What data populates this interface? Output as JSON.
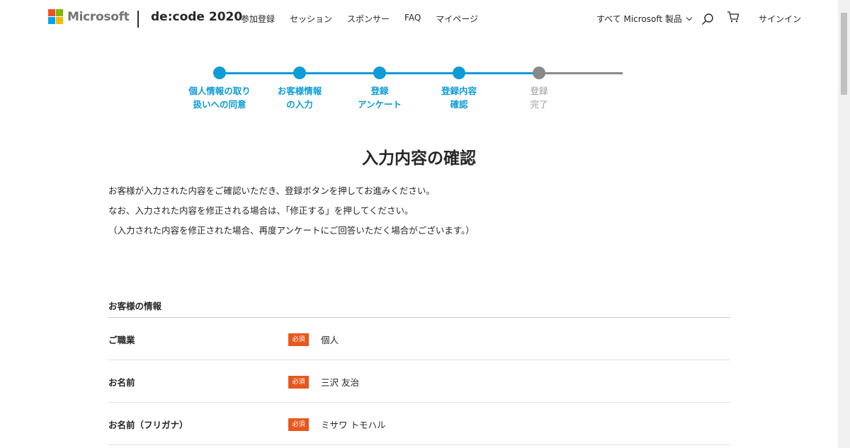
{
  "header": {
    "brand_text": "Microsoft",
    "logo_colors": [
      "#f25022",
      "#7fba00",
      "#00a4ef",
      "#ffb900"
    ],
    "site_title": "de:code 2020",
    "nav": [
      "参加登録",
      "セッション",
      "スポンサー",
      "FAQ",
      "マイページ"
    ],
    "all_microsoft": "すべて Microsoft 製品",
    "search_icon": "search-icon",
    "cart_icon": "cart-icon",
    "signin": "サインイン"
  },
  "steps": [
    {
      "label": "個人情報の取り\n扱いへの同意",
      "state": "done"
    },
    {
      "label": "お客様情報\nの入力",
      "state": "done"
    },
    {
      "label": "登録\nアンケート",
      "state": "done"
    },
    {
      "label": "登録内容\n確認",
      "state": "current"
    },
    {
      "label": "登録\n完了",
      "state": "pending"
    }
  ],
  "page_title": "入力内容の確認",
  "intro": [
    "お客様が入力された内容をご確認いただき、登録ボタンを押してお進みください。",
    "なお、入力された内容を修正される場合は、「修正する」を押してください。",
    "（入力された内容を修正された場合、再度アンケートにご回答いただく場合がございます。）"
  ],
  "section_title": "お客様の情報",
  "required_badge": "必須",
  "fields": [
    {
      "label": "ご職業",
      "value": "個人"
    },
    {
      "label": "お名前",
      "value": "三沢 友治"
    },
    {
      "label": "お名前（フリガナ）",
      "value": "ミサワ トモハル"
    }
  ],
  "colors": {
    "accent": "#0f9bd7",
    "pending": "#8a8a8a",
    "required_badge": "#e8571e"
  }
}
